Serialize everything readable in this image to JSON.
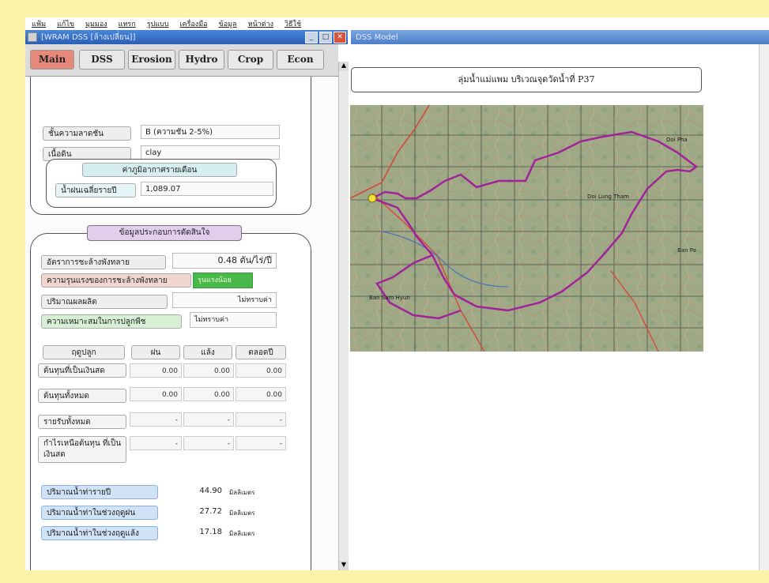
{
  "menu": [
    "แฟ้ม",
    "แก้ไข",
    "มุมมอง",
    "แทรก",
    "รูปแบบ",
    "เครื่องมือ",
    "ข้อมูล",
    "หน้าต่าง",
    "วิธีใช้"
  ],
  "left_window": {
    "title": "[WRAM DSS [ล้างเปลี่ยน]]"
  },
  "right_window": {
    "title": "DSS Model"
  },
  "tabs": [
    "Main",
    "DSS",
    "Erosion",
    "Hydro",
    "Crop",
    "Econ"
  ],
  "soil": {
    "slope_label": "ชั้นความลาดชัน",
    "slope_value": "B  (ความชัน 2-5%)",
    "texture_label": "เนื้อดิน",
    "texture_value": "clay"
  },
  "climate": {
    "header": "ค่าภูมิอากาศรายเดือน",
    "rain_label": "น้ำฝนเฉลี่ยรายปี",
    "rain_value": "1,089.07"
  },
  "decision": {
    "header": "ข้อมูลประกอบการตัดสินใจ",
    "erosion_rate_label": "อัตราการชะล้างพังทลาย",
    "erosion_rate_value": "0.48 ตัน/ไร่/ปี",
    "severity_label": "ความรุนแรงของการชะล้างพังทลาย",
    "severity_value": "รุนแรงน้อย",
    "yield_label": "ปริมาณผลผลิต",
    "yield_value": "ไม่ทราบค่า",
    "suitability_label": "ความเหมาะสมในการปลูกพืช",
    "suitability_value": "ไม่ทราบค่า",
    "season_header": "ฤดูปลูก",
    "col_headers": [
      "ฝน",
      "แล้ง",
      "ตลอดปี"
    ],
    "rows": [
      {
        "label": "ต้นทุนที่เป็นเงินสด",
        "values": [
          "0.00",
          "0.00",
          "0.00"
        ]
      },
      {
        "label": "ต้นทุนทั้งหมด",
        "values": [
          "0.00",
          "0.00",
          "0.00"
        ]
      },
      {
        "label": "รายรับทั้งหมด",
        "values": [
          "-",
          "-",
          "-"
        ]
      },
      {
        "label": "กำไรเหนือต้นทุน ที่เป็นเงินสด",
        "values": [
          "-",
          "-",
          "-"
        ]
      }
    ],
    "water": [
      {
        "label": "ปริมาณน้ำท่ารายปี",
        "value": "44.90",
        "unit": "มิลลิเมตร"
      },
      {
        "label": "ปริมาณน้ำท่าในช่วงฤดูฝน",
        "value": "27.72",
        "unit": "มิลลิเมตร"
      },
      {
        "label": "ปริมาณน้ำท่าในช่วงฤดูแล้ง",
        "value": "17.18",
        "unit": "มิลลิเมตร"
      }
    ]
  },
  "map": {
    "title": "ลุ่มน้ำแม่แพม บริเวณจุดวัดน้ำที่ P37",
    "place_labels": [
      "Doi Pha",
      "Doi Lung Tham",
      "Ban Pa",
      "Ban Sam Hyun"
    ]
  },
  "colors": {
    "active_tab": "#e7897a",
    "severity_bg": "#48b84a",
    "climate_header": "#d6eef2",
    "decision_header": "#e2cdec",
    "water_label_bg": "#cfe2f6",
    "boundary": "#a0239a",
    "page_bg": "#fbf3a8"
  }
}
